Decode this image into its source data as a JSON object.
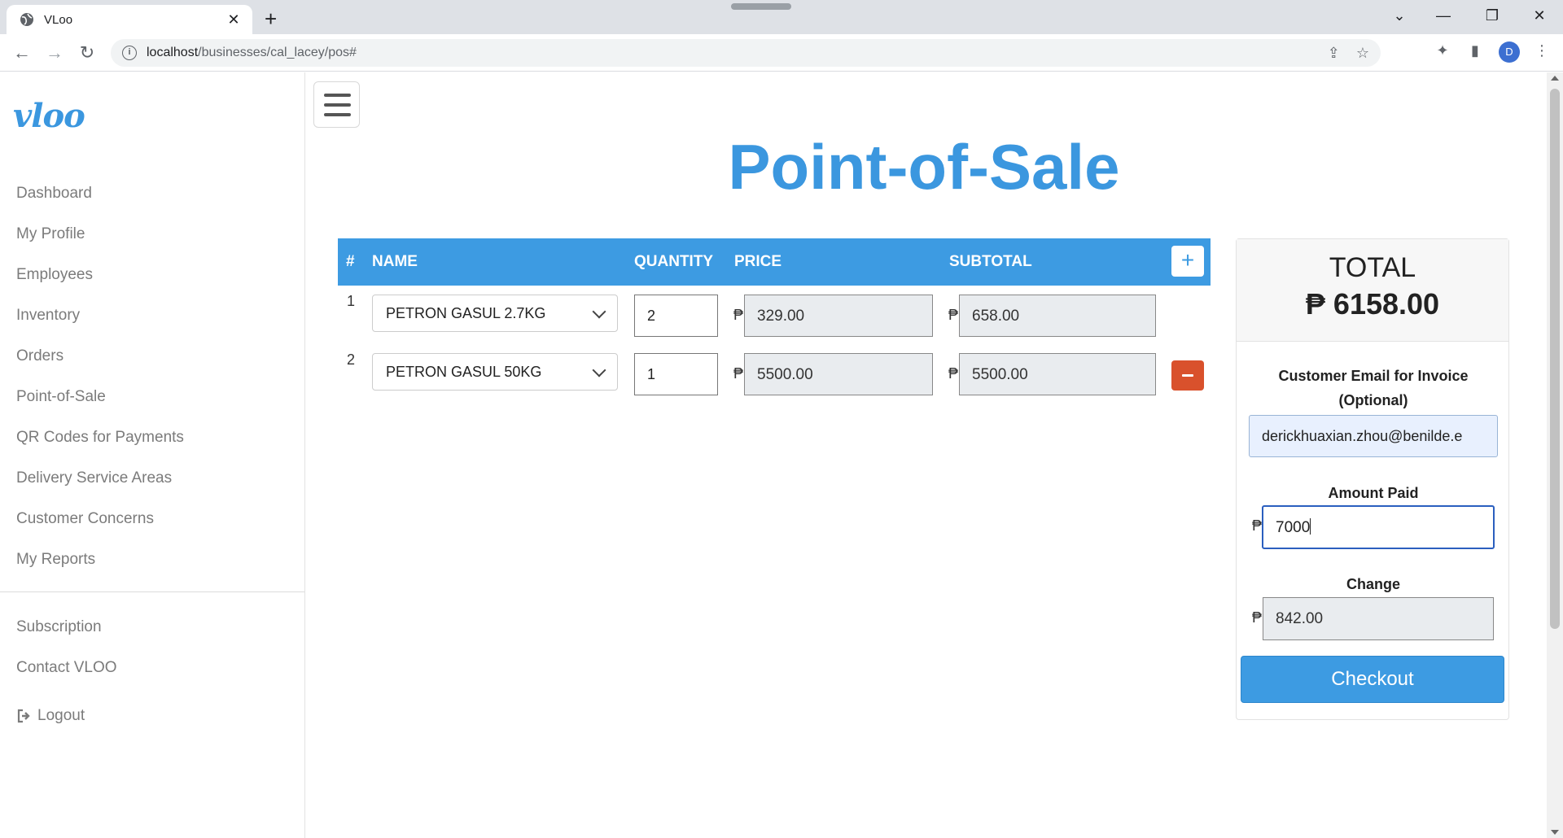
{
  "browser": {
    "tab_title": "VLoo",
    "url_host": "localhost",
    "url_path": "/businesses/cal_lacey/pos#",
    "profile_initial": "D"
  },
  "sidebar": {
    "logo": "vloo",
    "items": [
      {
        "label": "Dashboard"
      },
      {
        "label": "My Profile"
      },
      {
        "label": "Employees"
      },
      {
        "label": "Inventory"
      },
      {
        "label": "Orders"
      },
      {
        "label": "Point-of-Sale"
      },
      {
        "label": "QR Codes for Payments"
      },
      {
        "label": "Delivery Service Areas"
      },
      {
        "label": "Customer Concerns"
      },
      {
        "label": "My Reports"
      }
    ],
    "secondary": [
      {
        "label": "Subscription"
      },
      {
        "label": "Contact VLOO"
      }
    ],
    "logout": "Logout"
  },
  "page": {
    "title": "Point-of-Sale"
  },
  "table": {
    "headers": {
      "num": "#",
      "name": "NAME",
      "quantity": "QUANTITY",
      "price": "PRICE",
      "subtotal": "SUBTOTAL"
    },
    "currency": "₱",
    "rows": [
      {
        "num": "1",
        "product": "PETRON GASUL 2.7KG",
        "quantity": "2",
        "price": "329.00",
        "subtotal": "658.00"
      },
      {
        "num": "2",
        "product": "PETRON GASUL 50KG",
        "quantity": "1",
        "price": "5500.00",
        "subtotal": "5500.00"
      }
    ]
  },
  "summary": {
    "total_label": "TOTAL",
    "total_value": "₱ 6158.00",
    "email_label": "Customer Email for Invoice (Optional)",
    "email_value": "derickhuaxian.zhou@benilde.e",
    "amount_paid_label": "Amount Paid",
    "amount_paid_value": "7000",
    "change_label": "Change",
    "change_value": "842.00",
    "currency": "₱",
    "checkout_label": "Checkout"
  },
  "colors": {
    "accent": "#3d9be2",
    "danger": "#d9512c"
  }
}
